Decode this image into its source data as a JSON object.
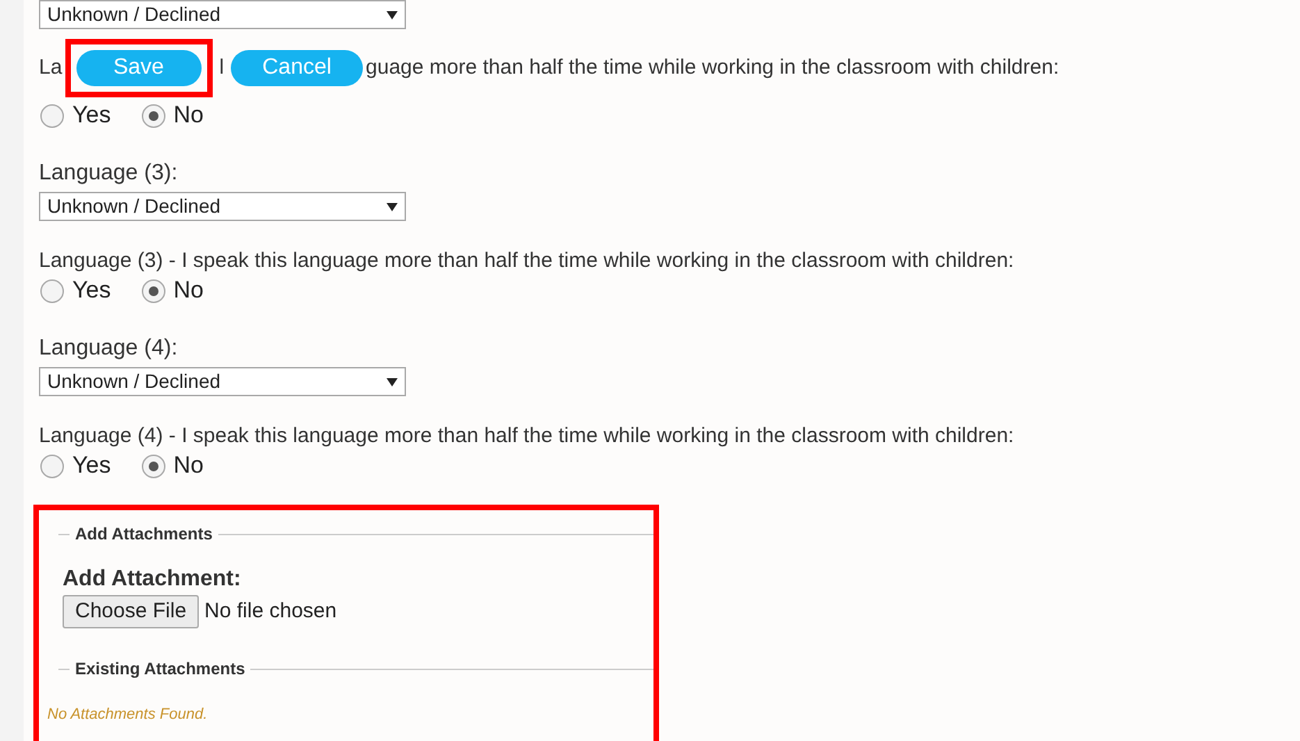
{
  "form": [
    {
      "kind": "select",
      "value": "Unknown / Declined"
    },
    {
      "kind": "covered_question",
      "fragments": [
        "La",
        "l"
      ],
      "text": "guage more than half the time while working in the classroom with children:",
      "options": [
        {
          "label": "Yes",
          "selected": false
        },
        {
          "label": "No",
          "selected": true
        }
      ]
    },
    {
      "kind": "select",
      "label": "Language (3):",
      "value": "Unknown / Declined"
    },
    {
      "kind": "question",
      "text": "Language (3) - I speak this language more than half the time while working in the classroom with children:",
      "options": [
        {
          "label": "Yes",
          "selected": false
        },
        {
          "label": "No",
          "selected": true
        }
      ]
    },
    {
      "kind": "select",
      "label": "Language (4):",
      "value": "Unknown / Declined"
    },
    {
      "kind": "question",
      "text": "Language (4) - I speak this language more than half the time while working in the classroom with children:",
      "options": [
        {
          "label": "Yes",
          "selected": false
        },
        {
          "label": "No",
          "selected": true
        }
      ]
    }
  ],
  "actions": [
    {
      "label": "Save",
      "highlighted": true
    },
    {
      "label": "Cancel",
      "highlighted": false
    }
  ],
  "attachments": {
    "highlighted": true,
    "add_legend": "Add Attachments",
    "add_label": "Add Attachment:",
    "file_button": "Choose File",
    "file_status": "No file chosen",
    "existing_legend": "Existing Attachments",
    "empty_message": "No Attachments Found."
  }
}
